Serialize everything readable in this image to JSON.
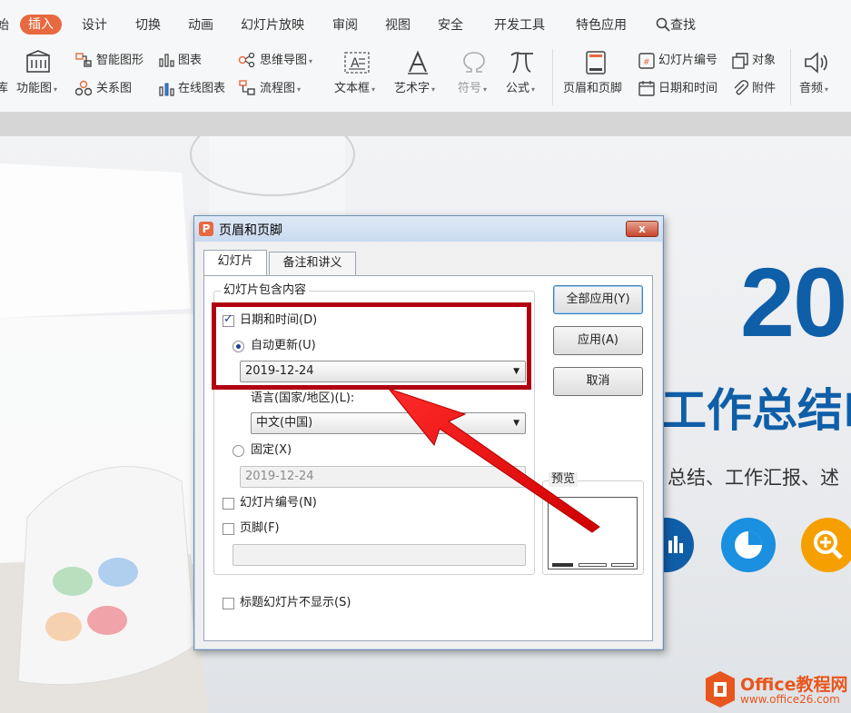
{
  "ribbon_tabs": {
    "start_label": "始",
    "insert": "插入",
    "design": "设计",
    "transition": "切换",
    "animation": "动画",
    "slideshow": "幻灯片放映",
    "review": "审阅",
    "view": "视图",
    "security": "安全",
    "developer": "开发工具",
    "special": "特色应用",
    "search": "查找"
  },
  "ribbon": {
    "cut_label": "库",
    "function_chart": "功能图",
    "smart_shape": "智能图形",
    "relation_chart": "关系图",
    "chart": "图表",
    "online_chart": "在线图表",
    "mind_map": "思维导图",
    "flow_chart": "流程图",
    "text_box": "文本框",
    "art_text": "艺术字",
    "symbol": "符号",
    "formula": "公式",
    "header_footer": "页眉和页脚",
    "slide_number": "幻灯片编号",
    "date_time": "日期和时间",
    "object": "对象",
    "attachment": "附件",
    "audio": "音频"
  },
  "slide": {
    "big_text": "20",
    "title": "工作总结P",
    "subtitle": "总结、工作汇报、述"
  },
  "watermark": {
    "brand": "Office教程网",
    "url": "www.office26.com"
  },
  "dialog": {
    "title": "页眉和页脚",
    "close": "x",
    "tabs": [
      "幻灯片",
      "备注和讲义"
    ],
    "group_label": "幻灯片包含内容",
    "date_time": {
      "label": "日期和时间(D)",
      "checked": true
    },
    "auto_update": {
      "label": "自动更新(U)",
      "selected": true,
      "value": "2019-12-24"
    },
    "language_label": "语言(国家/地区)(L):",
    "language_value": "中文(中国)",
    "fixed": {
      "label": "固定(X)",
      "selected": false,
      "value": "2019-12-24"
    },
    "slide_number": {
      "label": "幻灯片编号(N)",
      "checked": false
    },
    "footer": {
      "label": "页脚(F)",
      "checked": false,
      "value": ""
    },
    "hide_on_title": {
      "label": "标题幻灯片不显示(S)",
      "checked": false
    },
    "preview_label": "预览",
    "buttons": {
      "apply_all": "全部应用(Y)",
      "apply": "应用(A)",
      "cancel": "取消"
    }
  },
  "colors": {
    "accent": "#e8693f",
    "slide_blue": "#0f5ea8",
    "highlight": "#b10012"
  }
}
